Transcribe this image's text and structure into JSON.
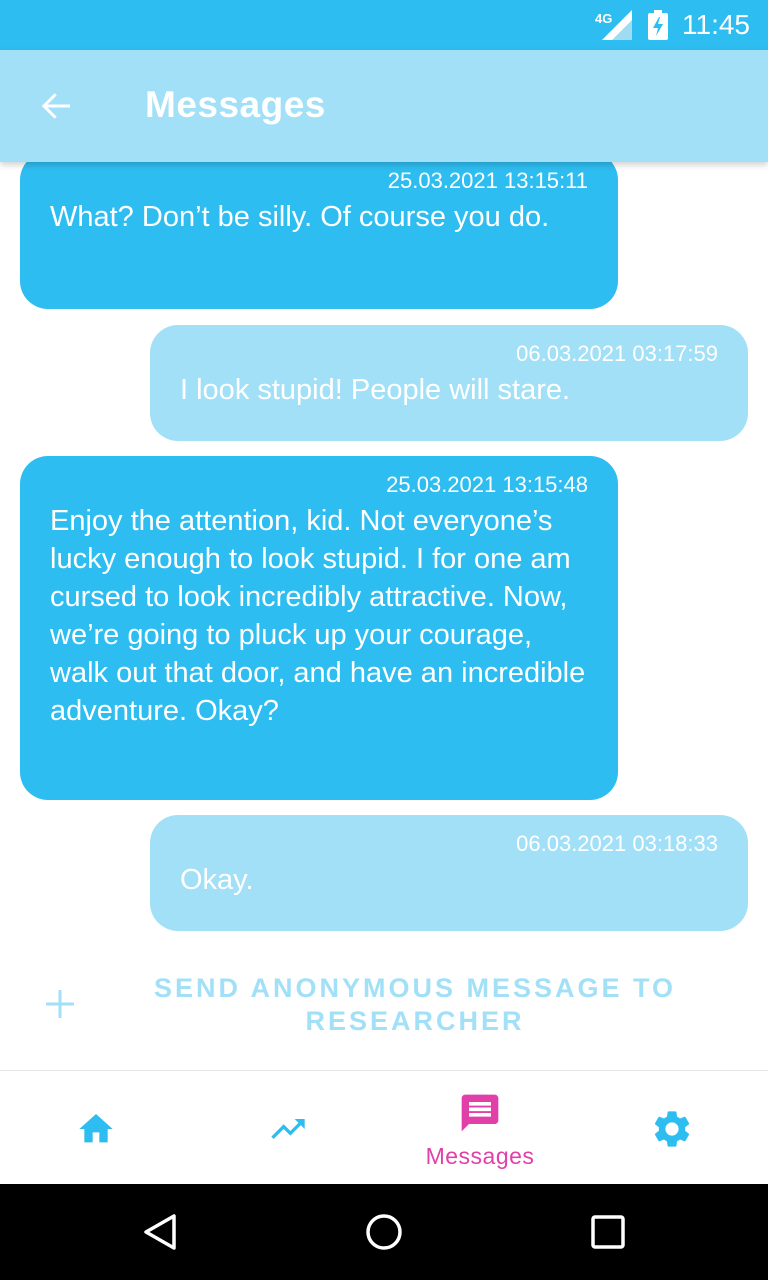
{
  "status_bar": {
    "network": "4G",
    "time": "11:45"
  },
  "app_bar": {
    "title": "Messages",
    "back_icon": "arrow-back-icon"
  },
  "messages": [
    {
      "direction": "received",
      "timestamp": "25.03.2021 13:15:11",
      "text": "What? Don’t be silly. Of course you do."
    },
    {
      "direction": "sent",
      "timestamp": "06.03.2021 03:17:59",
      "text": "I look stupid! People will stare."
    },
    {
      "direction": "received",
      "timestamp": "25.03.2021 13:15:48",
      "text": "Enjoy the attention, kid. Not everyone’s lucky enough to look stupid. I for one am cursed to look incredibly attractive. Now, we’re going to pluck up your courage, walk out that door, and have an incredible adventure. Okay?"
    },
    {
      "direction": "sent",
      "timestamp": "06.03.2021 03:18:33",
      "text": "Okay."
    }
  ],
  "send_action": {
    "label": "SEND ANONYMOUS MESSAGE TO RESEARCHER",
    "icon": "plus-icon"
  },
  "bottom_nav": {
    "items": [
      {
        "icon": "home-icon",
        "label": ""
      },
      {
        "icon": "trending-up-icon",
        "label": ""
      },
      {
        "icon": "message-icon",
        "label": "Messages",
        "active": true
      },
      {
        "icon": "gear-icon",
        "label": ""
      }
    ]
  },
  "colors": {
    "primary": "#2ebdf0",
    "primary_light": "#a2e0f7",
    "accent": "#e040a8",
    "white": "#ffffff",
    "system_nav": "#000000"
  }
}
